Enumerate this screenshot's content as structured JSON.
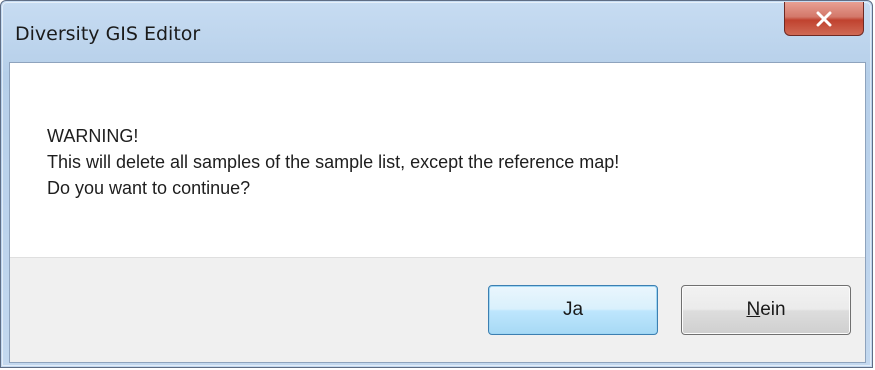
{
  "window": {
    "title": "Diversity GIS Editor",
    "close_icon": "close-icon"
  },
  "message": {
    "lines": [
      "WARNING!",
      "This will delete all samples of the sample list, except the reference map!",
      "Do you want to continue?"
    ]
  },
  "buttons": {
    "yes_label": "Ja",
    "no_label": "Nein"
  }
}
